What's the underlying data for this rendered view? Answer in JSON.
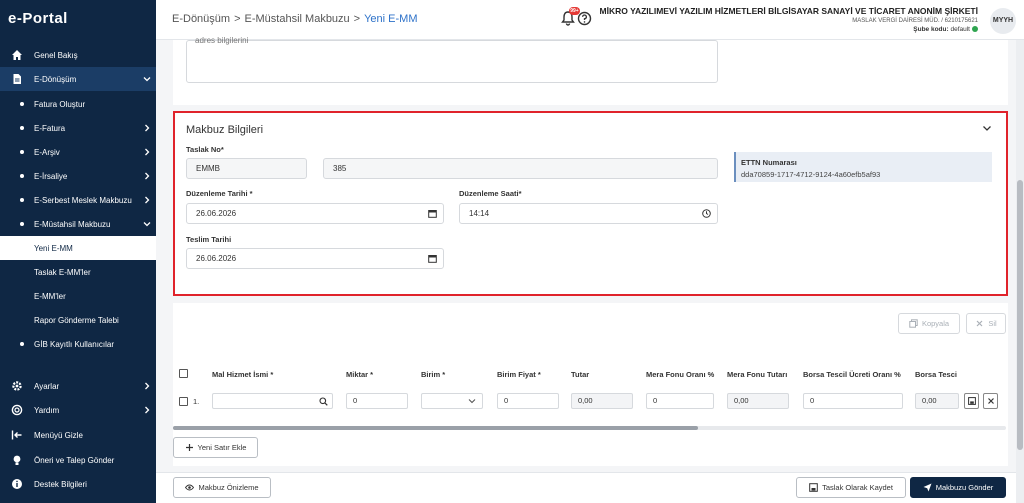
{
  "app": {
    "logo": "e-Portal"
  },
  "sidebar": {
    "items": [
      {
        "label": "Genel Bakış"
      },
      {
        "label": "E-Dönüşüm"
      },
      {
        "label": "Fatura Oluştur"
      },
      {
        "label": "E-Fatura"
      },
      {
        "label": "E-Arşiv"
      },
      {
        "label": "E-İrsaliye"
      },
      {
        "label": "E-Serbest Meslek Makbuzu"
      },
      {
        "label": "E-Müstahsil Makbuzu"
      },
      {
        "label": "Yeni E-MM"
      },
      {
        "label": "Taslak E-MM'ler"
      },
      {
        "label": "E-MM'ler"
      },
      {
        "label": "Rapor Gönderme Talebi"
      },
      {
        "label": "GİB Kayıtlı Kullanıcılar"
      },
      {
        "label": "Ayarlar"
      },
      {
        "label": "Yardım"
      },
      {
        "label": "Menüyü Gizle"
      },
      {
        "label": "Öneri ve Talep Gönder"
      },
      {
        "label": "Destek Bilgileri"
      }
    ]
  },
  "header": {
    "breadcrumb": [
      "E-Dönüşüm",
      ">",
      "E-Müstahsil Makbuzu",
      ">",
      "Yeni E-MM"
    ],
    "notification_count": "99+",
    "company_name": "MİKRO YAZILIMEVİ YAZILIM HİZMETLERİ BİLGİSAYAR SANAYİ VE TİCARET ANONİM ŞİRKETİ",
    "tax_info": "MASLAK VERGİ DAİRESİ MÜD. / 6210175621",
    "branch_label": "Şube kodu:",
    "branch_value": "default",
    "avatar": "MYYH"
  },
  "address": {
    "snippet": "adres bilgilerini"
  },
  "receipt": {
    "title": "Makbuz Bilgileri",
    "draft_no_label": "Taslak No*",
    "draft_prefix": "EMMB",
    "draft_number": "385",
    "ettn_label": "ETTN Numarası",
    "ettn_value": "dda70859-1717-4712-9124-4a60efb5af93",
    "issue_date_label": "Düzenleme Tarihi *",
    "issue_date": "26.06.2026",
    "issue_time_label": "Düzenleme Saati*",
    "issue_time": "14:14",
    "delivery_date_label": "Teslim Tarihi",
    "delivery_date": "26.06.2026"
  },
  "table": {
    "copy_label": "Kopyala",
    "delete_label": "Sil",
    "columns": [
      "Mal Hizmet İsmi *",
      "Miktar *",
      "Birim *",
      "Birim Fiyat *",
      "Tutar",
      "Mera Fonu Oranı %",
      "Mera Fonu Tutarı",
      "Borsa Tescil Ücreti Oranı %",
      "Borsa Tesci"
    ],
    "row": {
      "index": "1.",
      "qty": "0",
      "unit_price": "0",
      "amount": "0,00",
      "fund_rate": "0",
      "fund_amount": "0,00",
      "exchange_rate": "0",
      "exchange_amount": "0,00"
    },
    "add_row_label": "Yeni Satır Ekle"
  },
  "footer": {
    "preview_label": "Makbuz Önizleme",
    "save_draft_label": "Taslak Olarak Kaydet",
    "send_label": "Makbuzu Gönder"
  },
  "colors": {
    "sidebar": "#0f2744",
    "accent": "#2e72c9",
    "highlight": "#e0232b",
    "badge": "#e53935"
  }
}
